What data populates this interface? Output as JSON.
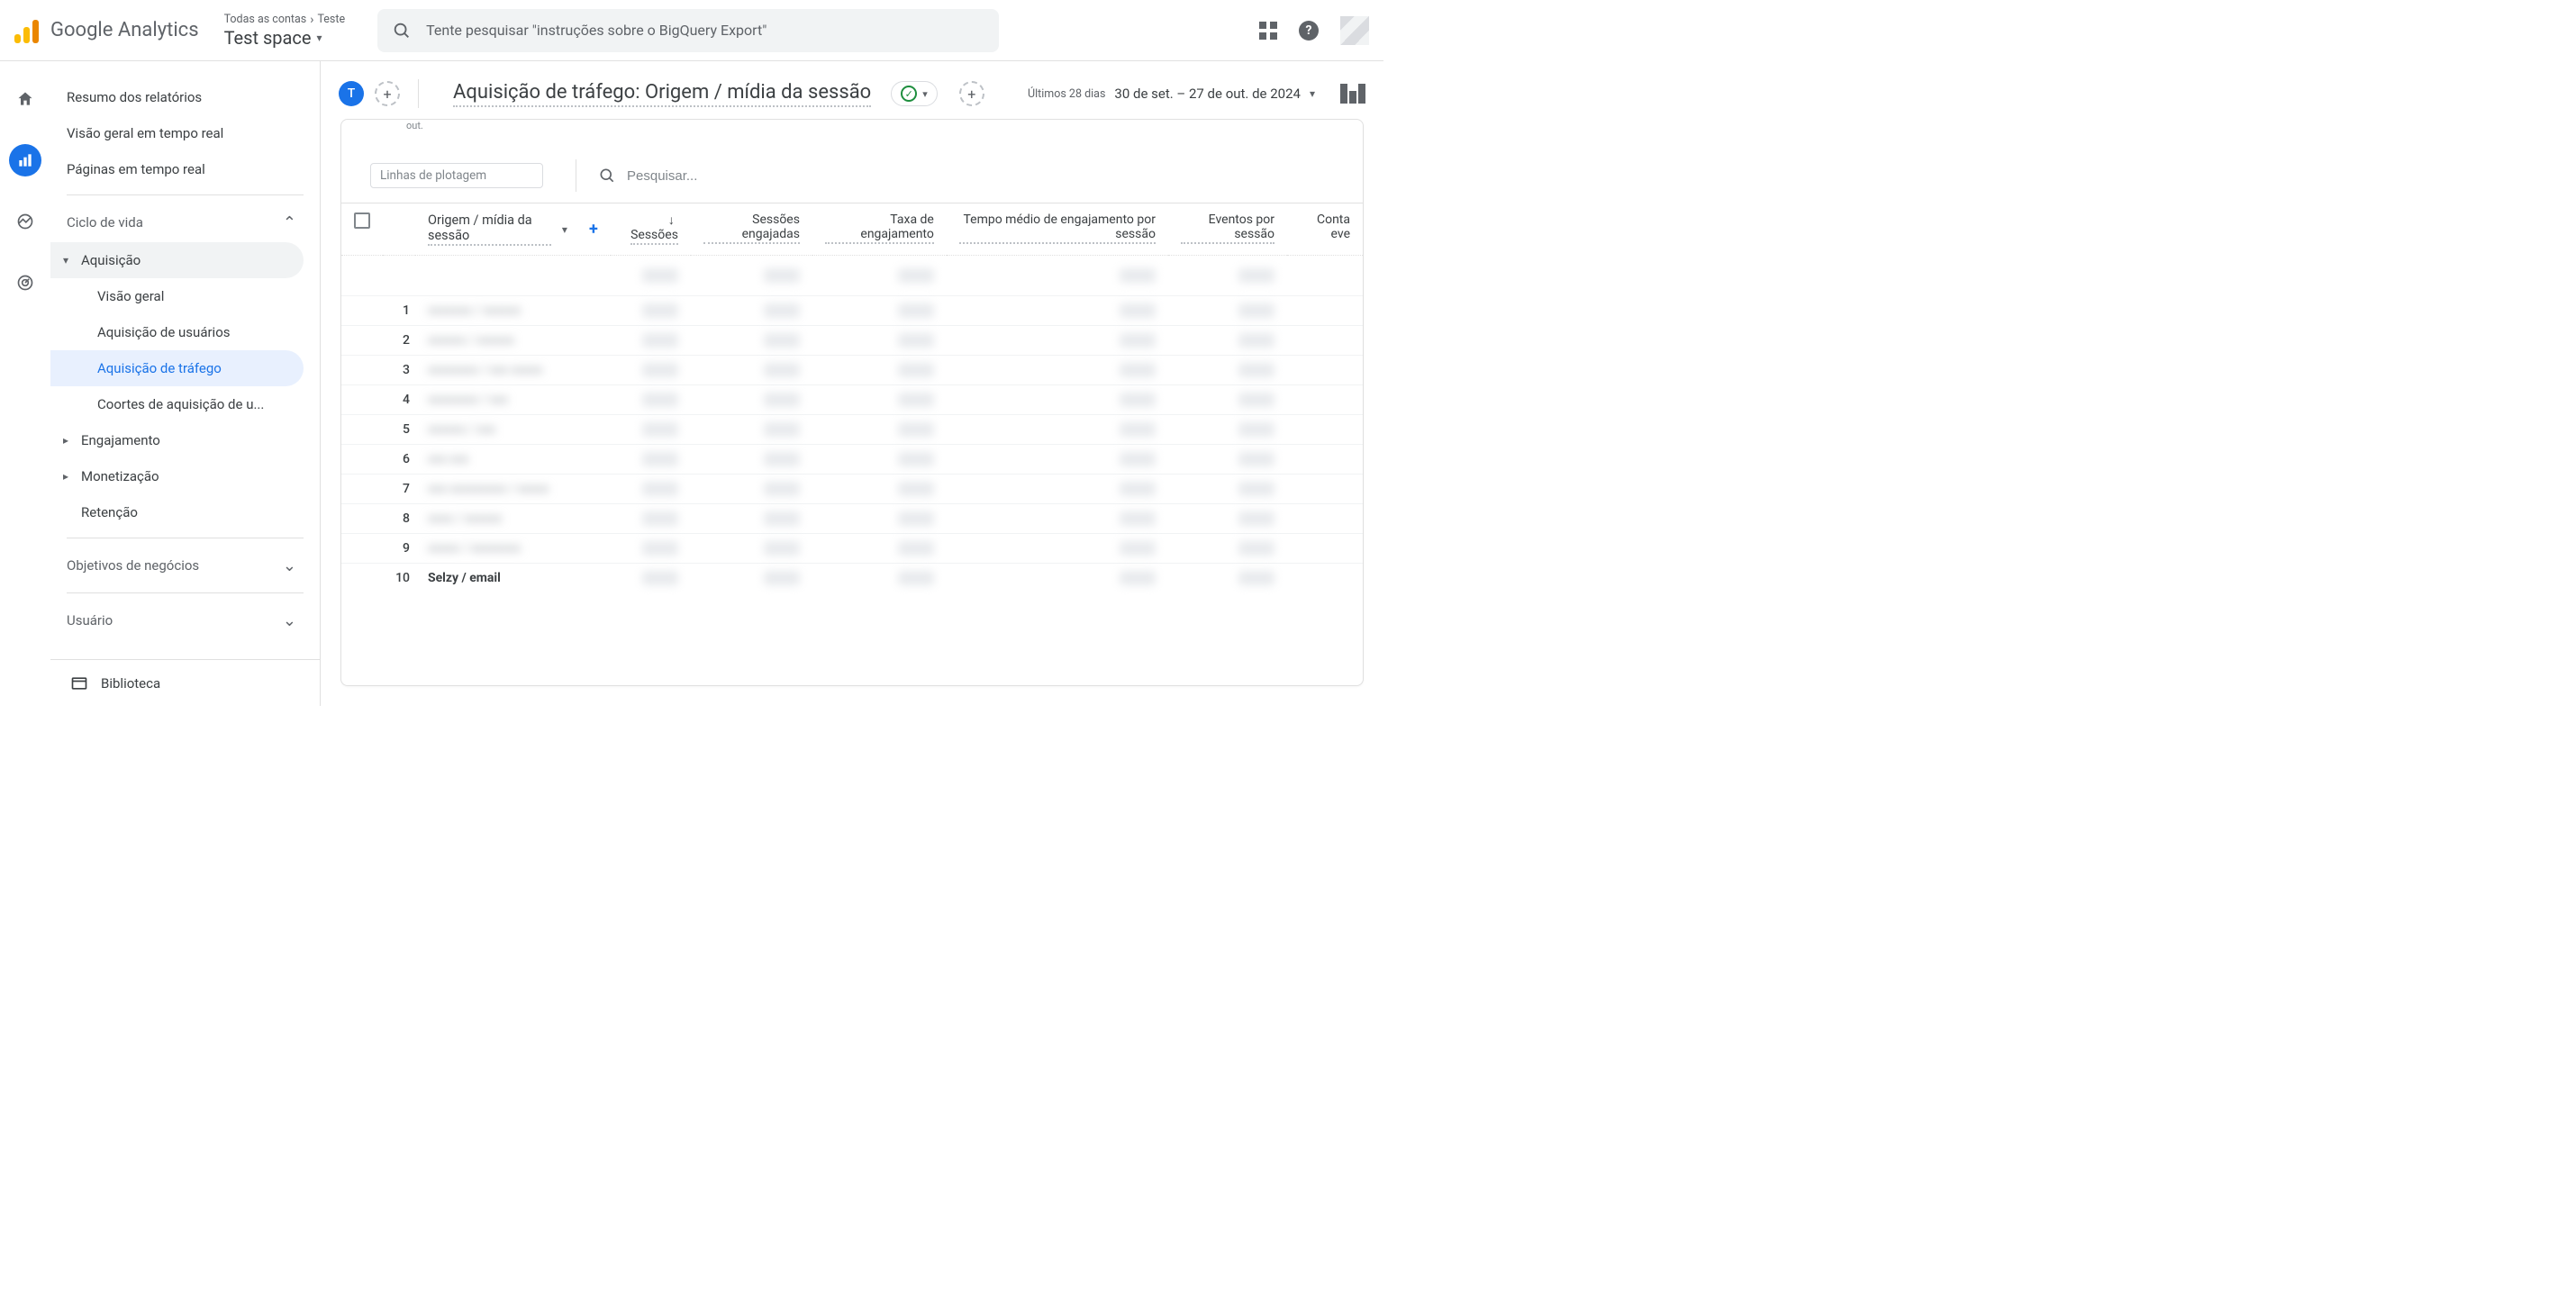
{
  "header": {
    "product": "Google Analytics",
    "breadcrumb_all": "Todas as contas",
    "breadcrumb_property": "Teste",
    "property_name": "Test space",
    "search_placeholder": "Tente pesquisar \"instruções sobre o BigQuery Export\""
  },
  "sidebar": {
    "item_resumo": "Resumo dos relatórios",
    "item_visao_geral_rt": "Visão geral em tempo real",
    "item_paginas_rt": "Páginas em tempo real",
    "group_ciclo": "Ciclo de vida",
    "item_aquisicao": "Aquisição",
    "item_aq_visao": "Visão geral",
    "item_aq_usuarios": "Aquisição de usuários",
    "item_aq_trafego": "Aquisição de tráfego",
    "item_aq_coortes": "Coortes de aquisição de u...",
    "item_engajamento": "Engajamento",
    "item_monetizacao": "Monetização",
    "item_retencao": "Retenção",
    "group_objetivos": "Objetivos de negócios",
    "group_usuario": "Usuário",
    "biblioteca": "Biblioteca"
  },
  "report": {
    "chip_letter": "T",
    "title": "Aquisição de tráfego: Origem / mídia da sessão",
    "date_label": "Últimos 28 dias",
    "date_range": "30 de set. – 27 de out. de 2024",
    "chart_stub": "out.",
    "plot_placeholder": "Linhas de plotagem",
    "search_placeholder": "Pesquisar...",
    "dim_header": "Origem / mídia da sessão",
    "col_sessoes": "Sessões",
    "col_engajadas": "Sessões engajadas",
    "col_taxa": "Taxa de engajamento",
    "col_tempo": "Tempo médio de engajamento por sessão",
    "col_eventos": "Eventos por sessão",
    "col_contagens": "Conta eve"
  },
  "rows": [
    {
      "idx": "1",
      "dim": "xxxxxxx / xxxxxx",
      "blurred": true
    },
    {
      "idx": "2",
      "dim": "xxxxxx / xxxxxx",
      "blurred": true
    },
    {
      "idx": "3",
      "dim": "xxxxxxxx / xxx xxxxx",
      "blurred": true
    },
    {
      "idx": "4",
      "dim": "xxxxxxxx / xxx",
      "blurred": true
    },
    {
      "idx": "5",
      "dim": "xxxxxx / xxx",
      "blurred": true
    },
    {
      "idx": "6",
      "dim": "xxx xxx",
      "blurred": true
    },
    {
      "idx": "7",
      "dim": "xxx xxxxxxxxx / xxxxx",
      "blurred": true
    },
    {
      "idx": "8",
      "dim": "xxxx / xxxxxx",
      "blurred": true
    },
    {
      "idx": "9",
      "dim": "xxxxx / xxxxxxxx",
      "blurred": true
    },
    {
      "idx": "10",
      "dim": "Selzy / email",
      "blurred": false
    }
  ]
}
